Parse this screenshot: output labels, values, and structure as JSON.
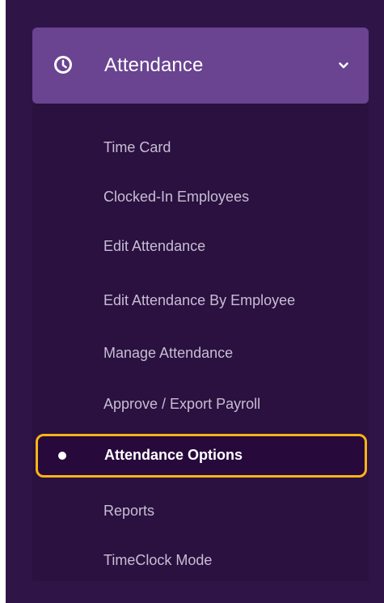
{
  "colors": {
    "panel_background": "#2f1547",
    "header_background": "#6a4391",
    "submenu_background": "#2a1140",
    "highlight_border": "#fcb416",
    "item_text": "#c8bdd3",
    "active_text": "#ffffff"
  },
  "nav": {
    "section": {
      "icon": "clock-icon",
      "label": "Attendance",
      "expanded": true,
      "chevron_icon": "chevron-down-icon"
    },
    "items": [
      {
        "label": "Time Card"
      },
      {
        "label": "Clocked-In Employees"
      },
      {
        "label": "Edit Attendance"
      },
      {
        "label": "Edit Attendance By Employee"
      },
      {
        "label": "Manage Attendance"
      },
      {
        "label": "Approve / Export Payroll"
      },
      {
        "label": "Attendance Options",
        "active": true,
        "indicator_icon": "bullet-dot-icon"
      },
      {
        "label": "Reports"
      },
      {
        "label": "TimeClock Mode"
      }
    ]
  }
}
